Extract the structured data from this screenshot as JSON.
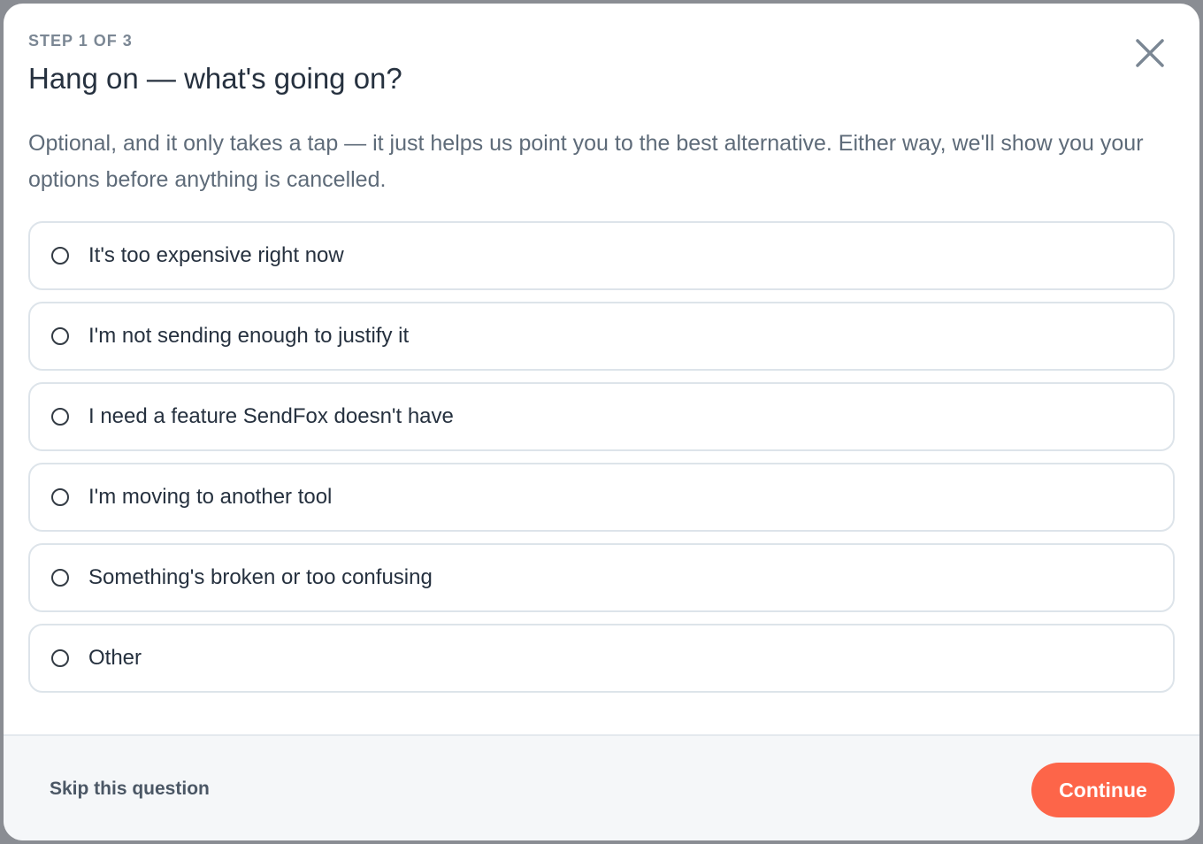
{
  "dialog": {
    "step_label": "STEP 1 OF 3",
    "title": "Hang on — what's going on?",
    "description": "Optional, and it only takes a tap — it just helps us point you to the best alternative. Either way, we'll show you your options before anything is cancelled.",
    "close_icon": "close-icon"
  },
  "options": [
    {
      "label": "It's too expensive right now",
      "selected": false
    },
    {
      "label": "I'm not sending enough to justify it",
      "selected": false
    },
    {
      "label": "I need a feature SendFox doesn't have",
      "selected": false
    },
    {
      "label": "I'm moving to another tool",
      "selected": false
    },
    {
      "label": "Something's broken or too confusing",
      "selected": false
    },
    {
      "label": "Other",
      "selected": false
    }
  ],
  "footer": {
    "skip_label": "Skip this question",
    "continue_label": "Continue"
  },
  "colors": {
    "accent": "#fd6549",
    "text_primary": "#26313f",
    "text_secondary": "#5e6b79",
    "border": "#dde4ea"
  }
}
